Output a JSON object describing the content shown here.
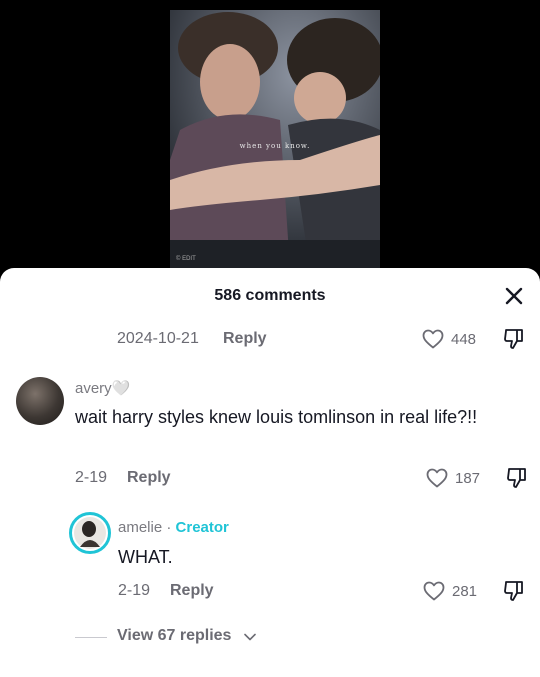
{
  "video": {
    "caption": "when you know.",
    "watermark": "© EDIT"
  },
  "sheet": {
    "title": "586 comments"
  },
  "parent_comment": {
    "date": "2024-10-21",
    "reply_label": "Reply",
    "likes": "448"
  },
  "comments": [
    {
      "username": "avery🤍",
      "text": "wait harry styles knew louis tomlinson in real life?!!",
      "date": "2-19",
      "reply_label": "Reply",
      "likes": "187"
    },
    {
      "username": "amelie",
      "separator": " · ",
      "badge": "Creator",
      "text": "WHAT.",
      "date": "2-19",
      "reply_label": "Reply",
      "likes": "281"
    }
  ],
  "view_replies": "View 67 replies",
  "colors": {
    "creator_accent": "#20c4d6",
    "secondary_text": "#6b6b73",
    "primary_text": "#161823"
  }
}
